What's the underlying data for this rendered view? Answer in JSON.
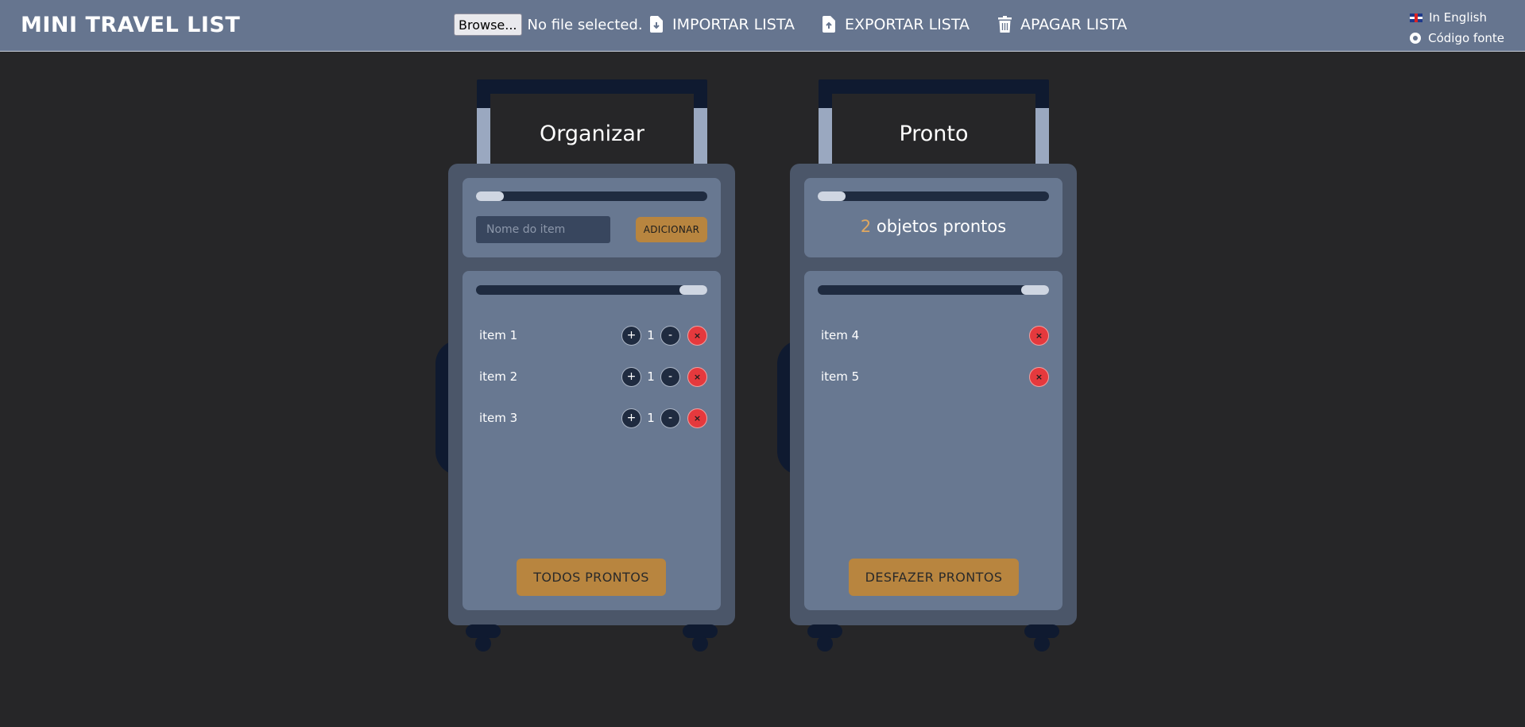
{
  "header": {
    "title": "MINI TRAVEL LIST",
    "browse_label": "Browse...",
    "file_status": "No file selected.",
    "import_label": "IMPORTAR LISTA",
    "export_label": "EXPORTAR LISTA",
    "delete_label": "APAGAR LISTA",
    "language_link": "In English",
    "source_link": "Código fonte"
  },
  "organize": {
    "title": "Organizar",
    "input_placeholder": "Nome do item",
    "add_label": "ADICIONAR",
    "items": [
      {
        "label": "item 1",
        "qty": "1",
        "plus": "+",
        "minus": "-",
        "del": "×"
      },
      {
        "label": "item 2",
        "qty": "1",
        "plus": "+",
        "minus": "-",
        "del": "×"
      },
      {
        "label": "item 3",
        "qty": "1",
        "plus": "+",
        "minus": "-",
        "del": "×"
      }
    ],
    "all_ready_label": "TODOS PRONTOS"
  },
  "ready": {
    "title": "Pronto",
    "count": "2",
    "count_suffix": " objetos prontos",
    "items": [
      {
        "label": "item 4",
        "del": "×"
      },
      {
        "label": "item 5",
        "del": "×"
      }
    ],
    "undo_label": "DESFAZER PRONTOS"
  },
  "colors": {
    "header_bg": "#66758f",
    "page_bg": "#262628",
    "accent": "#b8853f",
    "delete": "#e5393d"
  }
}
